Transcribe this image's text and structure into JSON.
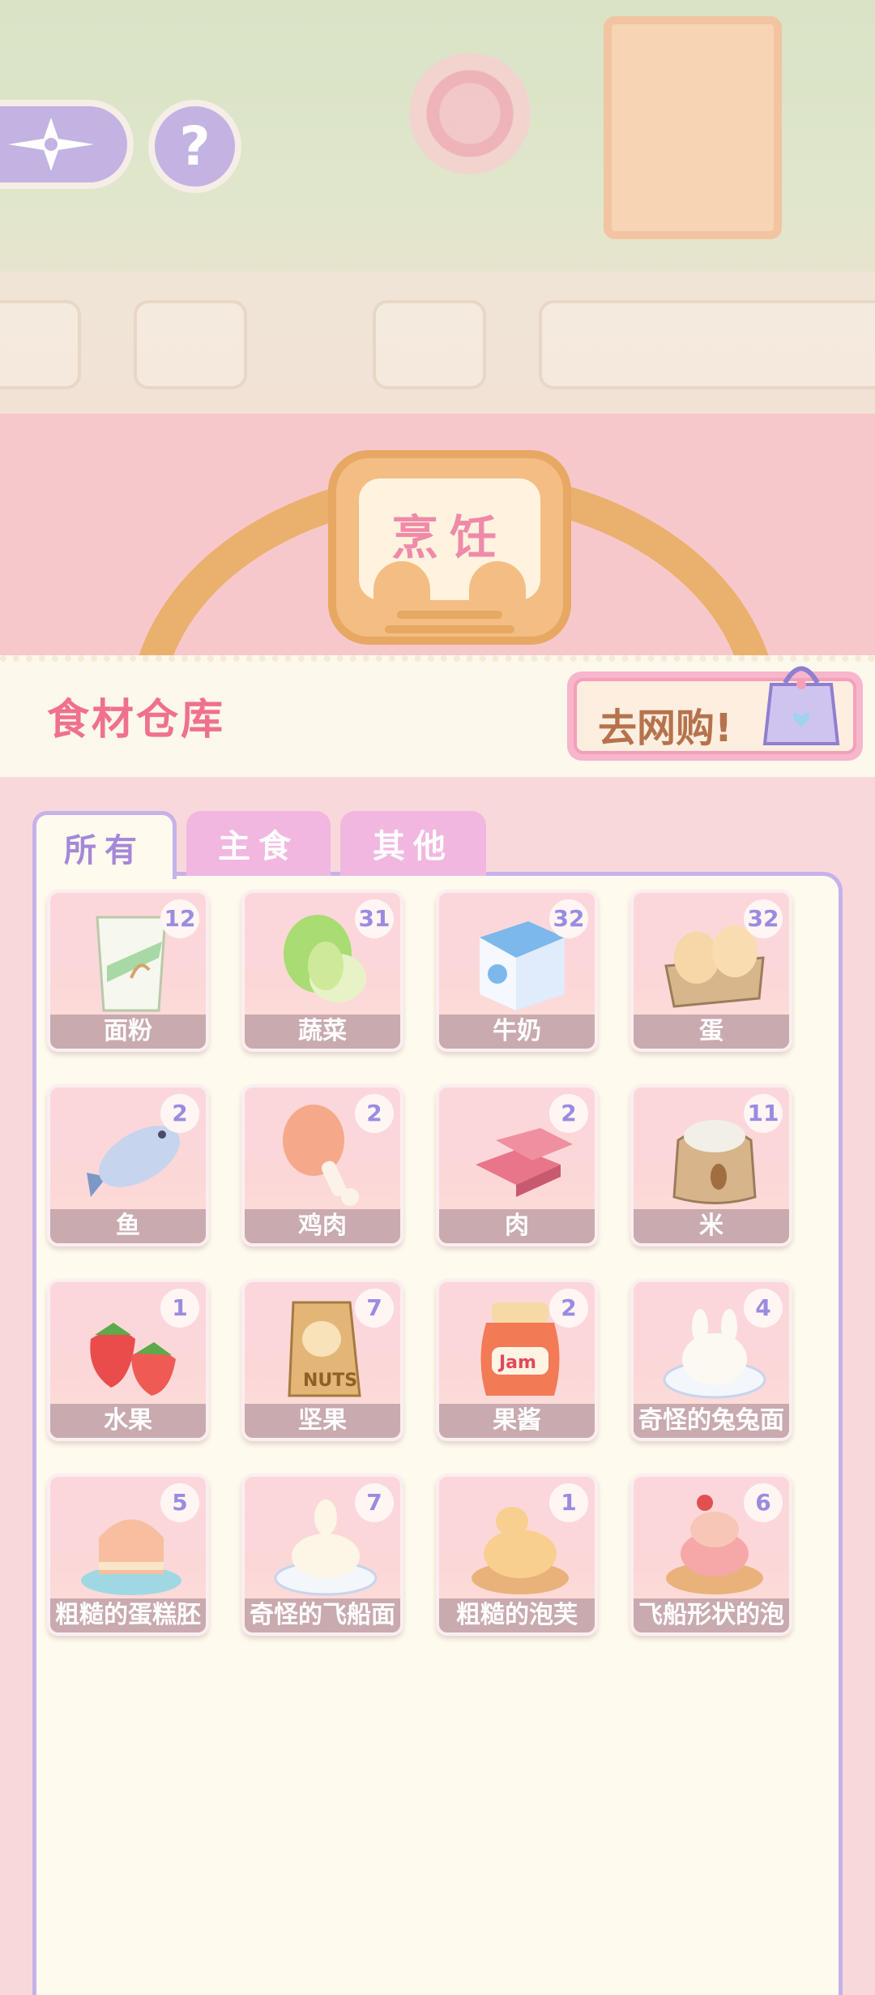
{
  "help_button": {
    "label": "?"
  },
  "cook_sign": {
    "label": "烹饪"
  },
  "header": {
    "title": "食材仓库",
    "shop_label": "去网购!"
  },
  "tabs": [
    {
      "label": "所有",
      "active": true
    },
    {
      "label": "主食",
      "active": false
    },
    {
      "label": "其他",
      "active": false
    }
  ],
  "items": [
    {
      "name": "面粉",
      "count": "12",
      "icon": "flour-bag-icon"
    },
    {
      "name": "蔬菜",
      "count": "31",
      "icon": "cabbage-icon"
    },
    {
      "name": "牛奶",
      "count": "32",
      "icon": "milk-carton-icon"
    },
    {
      "name": "蛋",
      "count": "32",
      "icon": "eggs-icon"
    },
    {
      "name": "鱼",
      "count": "2",
      "icon": "fish-icon"
    },
    {
      "name": "鸡肉",
      "count": "2",
      "icon": "chicken-leg-icon"
    },
    {
      "name": "肉",
      "count": "2",
      "icon": "meat-icon"
    },
    {
      "name": "米",
      "count": "11",
      "icon": "rice-sack-icon"
    },
    {
      "name": "水果",
      "count": "1",
      "icon": "strawberry-icon"
    },
    {
      "name": "坚果",
      "count": "7",
      "icon": "nuts-bag-icon"
    },
    {
      "name": "果酱",
      "count": "2",
      "icon": "jam-jar-icon"
    },
    {
      "name": "奇怪的兔兔面",
      "count": "4",
      "icon": "bunny-noodles-icon"
    },
    {
      "name": "粗糙的蛋糕胚",
      "count": "5",
      "icon": "cake-base-icon"
    },
    {
      "name": "奇怪的飞船面",
      "count": "7",
      "icon": "spaceship-noodles-icon"
    },
    {
      "name": "粗糙的泡芙",
      "count": "1",
      "icon": "puff-icon"
    },
    {
      "name": "飞船形状的泡",
      "count": "6",
      "icon": "spaceship-puff-icon"
    }
  ],
  "jam_text": "Jam",
  "nuts_text": "NUTS",
  "colors": {
    "accent_purple": "#c3b3e3",
    "title_pink": "#f0708f",
    "panel_bg": "#fefaee",
    "label_bg": "#c9aaaf",
    "count_color": "#9b8be0"
  }
}
